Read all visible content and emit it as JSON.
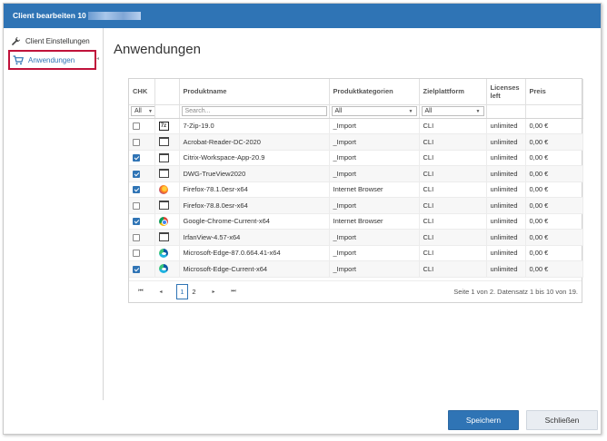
{
  "dialog": {
    "title": "Client bearbeiten 10",
    "title_redacted": true
  },
  "sidebar": {
    "items": [
      {
        "label": "Client Einstellungen",
        "icon": "wrench-icon"
      },
      {
        "label": "Anwendungen",
        "icon": "cart-icon",
        "selected": true
      }
    ]
  },
  "main": {
    "title": "Anwendungen"
  },
  "grid": {
    "columns": {
      "chk": "CHK",
      "name": "Produktname",
      "category": "Produktkategorien",
      "platform": "Zielplattform",
      "licenses": "Licenses left",
      "price": "Preis"
    },
    "filters": {
      "chk": "All",
      "search_placeholder": "Search...",
      "category": "All",
      "platform": "All"
    },
    "rows": [
      {
        "checked": false,
        "icon": "zip",
        "name": "7-Zip-19.0",
        "category": "_Import",
        "platform": "CLI",
        "licenses": "unlimited",
        "price": "0,00 €"
      },
      {
        "checked": false,
        "icon": "window",
        "name": "Acrobat-Reader-DC-2020",
        "category": "_Import",
        "platform": "CLI",
        "licenses": "unlimited",
        "price": "0,00 €"
      },
      {
        "checked": true,
        "icon": "window",
        "name": "Citrix-Workspace-App-20.9",
        "category": "_Import",
        "platform": "CLI",
        "licenses": "unlimited",
        "price": "0,00 €"
      },
      {
        "checked": true,
        "icon": "window",
        "name": "DWG-TrueView2020",
        "category": "_Import",
        "platform": "CLI",
        "licenses": "unlimited",
        "price": "0,00 €"
      },
      {
        "checked": true,
        "icon": "firefox",
        "name": "Firefox-78.1.0esr-x64",
        "category": "Internet Browser",
        "platform": "CLI",
        "licenses": "unlimited",
        "price": "0,00 €"
      },
      {
        "checked": false,
        "icon": "window",
        "name": "Firefox-78.8.0esr-x64",
        "category": "_Import",
        "platform": "CLI",
        "licenses": "unlimited",
        "price": "0,00 €"
      },
      {
        "checked": true,
        "icon": "chrome",
        "name": "Google-Chrome-Current-x64",
        "category": "Internet Browser",
        "platform": "CLI",
        "licenses": "unlimited",
        "price": "0,00 €"
      },
      {
        "checked": false,
        "icon": "window",
        "name": "IrfanView-4.57-x64",
        "category": "_Import",
        "platform": "CLI",
        "licenses": "unlimited",
        "price": "0,00 €"
      },
      {
        "checked": false,
        "icon": "edge",
        "name": "Microsoft-Edge-87.0.664.41-x64",
        "category": "_Import",
        "platform": "CLI",
        "licenses": "unlimited",
        "price": "0,00 €"
      },
      {
        "checked": true,
        "icon": "edge",
        "name": "Microsoft-Edge-Current-x64",
        "category": "_Import",
        "platform": "CLI",
        "licenses": "unlimited",
        "price": "0,00 €"
      }
    ]
  },
  "pager": {
    "pages": [
      "1",
      "2"
    ],
    "current_page": "1",
    "info": "Seite 1 von 2. Datensatz 1 bis 10 von 19."
  },
  "footer": {
    "save_label": "Speichern",
    "close_label": "Schließen"
  },
  "colors": {
    "accent": "#2f74b5",
    "selection_border": "#c0123a"
  }
}
